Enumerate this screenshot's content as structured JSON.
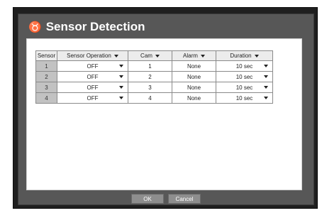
{
  "dialog": {
    "title": "Sensor Detection",
    "title_icon": "sensor-icon",
    "ok_label": "OK",
    "cancel_label": "Cancel"
  },
  "table": {
    "headers": {
      "sensor": "Sensor",
      "sensor_operation": "Sensor Operation",
      "cam": "Cam",
      "alarm": "Alarm",
      "duration": "Duration"
    },
    "rows": [
      {
        "sensor": "1",
        "operation": "OFF",
        "cam": "1",
        "alarm": "None",
        "duration": "10 sec"
      },
      {
        "sensor": "2",
        "operation": "OFF",
        "cam": "2",
        "alarm": "None",
        "duration": "10 sec"
      },
      {
        "sensor": "3",
        "operation": "OFF",
        "cam": "3",
        "alarm": "None",
        "duration": "10 sec"
      },
      {
        "sensor": "4",
        "operation": "OFF",
        "cam": "4",
        "alarm": "None",
        "duration": "10 sec"
      }
    ]
  }
}
